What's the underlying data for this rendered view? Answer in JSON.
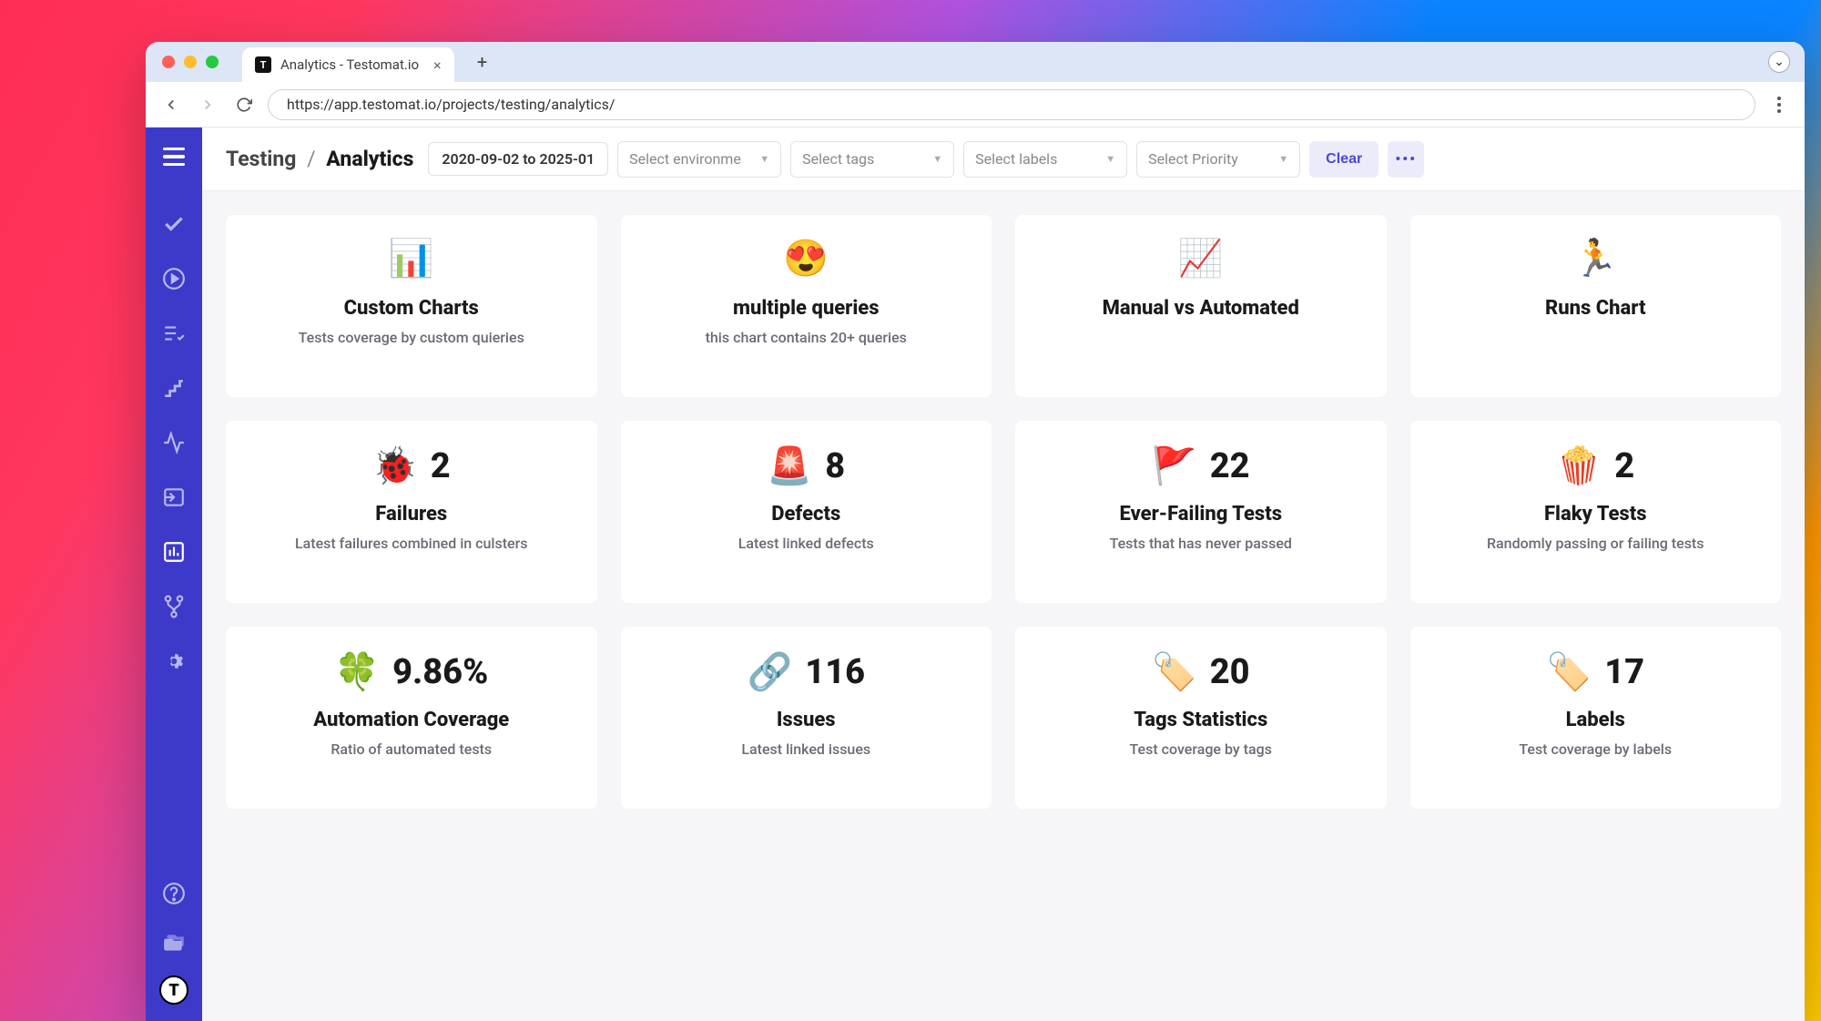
{
  "browser": {
    "tab_title": "Analytics - Testomat.io",
    "url": "https://app.testomat.io/projects/testing/analytics/"
  },
  "breadcrumb": {
    "parent": "Testing",
    "current": "Analytics"
  },
  "header": {
    "date_range": "2020-09-02 to 2025-01",
    "filters": {
      "environment_placeholder": "Select environme",
      "tags_placeholder": "Select tags",
      "labels_placeholder": "Select labels",
      "priority_placeholder": "Select Priority"
    },
    "clear_label": "Clear"
  },
  "cards": [
    {
      "emoji": "📊",
      "title": "Custom Charts",
      "subtitle": "Tests coverage by custom quieries"
    },
    {
      "emoji": "😍",
      "title": "multiple queries",
      "subtitle": "this chart contains 20+ queries"
    },
    {
      "emoji": "📈",
      "title": "Manual vs Automated",
      "subtitle": ""
    },
    {
      "emoji": "🏃",
      "title": "Runs Chart",
      "subtitle": ""
    },
    {
      "emoji": "🐞",
      "value": "2",
      "title": "Failures",
      "subtitle": "Latest failures combined in culsters"
    },
    {
      "emoji": "🚨",
      "value": "8",
      "title": "Defects",
      "subtitle": "Latest linked defects"
    },
    {
      "emoji": "🚩",
      "value": "22",
      "title": "Ever-Failing Tests",
      "subtitle": "Tests that has never passed"
    },
    {
      "emoji": "🍿",
      "value": "2",
      "title": "Flaky Tests",
      "subtitle": "Randomly passing or failing tests"
    },
    {
      "emoji": "🍀",
      "value": "9.86%",
      "title": "Automation Coverage",
      "subtitle": "Ratio of automated tests"
    },
    {
      "emoji": "🔗",
      "value": "116",
      "title": "Issues",
      "subtitle": "Latest linked issues"
    },
    {
      "emoji": "🏷️",
      "value": "20",
      "title": "Tags Statistics",
      "subtitle": "Test coverage by tags"
    },
    {
      "emoji": "🏷️",
      "value": "17",
      "title": "Labels",
      "subtitle": "Test coverage by labels"
    }
  ]
}
